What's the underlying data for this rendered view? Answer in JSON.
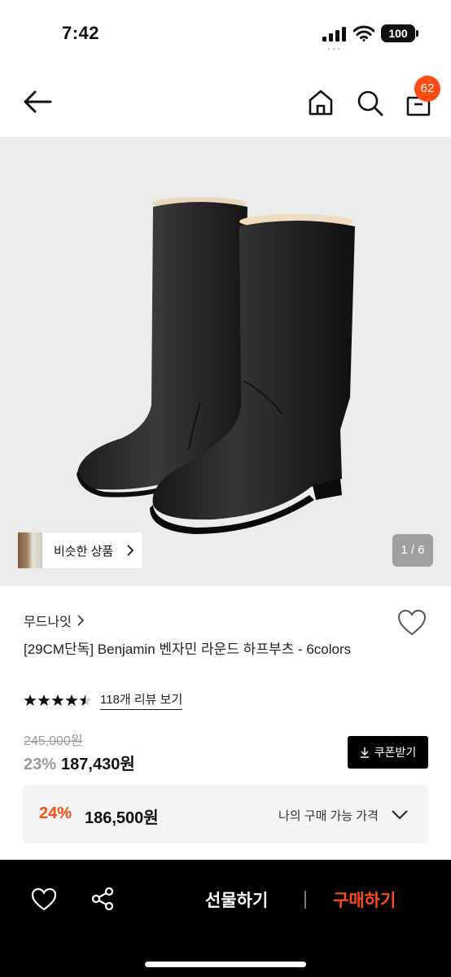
{
  "status_bar": {
    "time": "7:42",
    "battery": "100",
    "icons": [
      "signal-icon",
      "wifi-icon",
      "battery-icon"
    ]
  },
  "nav": {
    "cart_badge": "62",
    "icons": [
      "back-arrow-icon",
      "home-icon",
      "search-icon",
      "cart-icon"
    ]
  },
  "hero": {
    "similar_label": "비슷한 상품",
    "pager": "1 / 6",
    "background": "#ececec"
  },
  "product": {
    "brand": "무드나잇",
    "title": "[29CM단독] Benjamin 벤자민 라운드 하프부츠 - 6colors",
    "rating": 4.5,
    "review_link": "118개 리뷰 보기",
    "original_price": "245,000원",
    "discount": "23%",
    "price": "187,430원",
    "coupon_label": "쿠폰받기",
    "my_discount": "24%",
    "my_price": "186,500원",
    "my_price_label": "나의 구매 가능 가격"
  },
  "bottom_bar": {
    "gift_label": "선물하기",
    "buy_label": "구매하기"
  },
  "colors": {
    "accent": "#ff4b14",
    "text": "#111111",
    "muted": "#999999"
  }
}
